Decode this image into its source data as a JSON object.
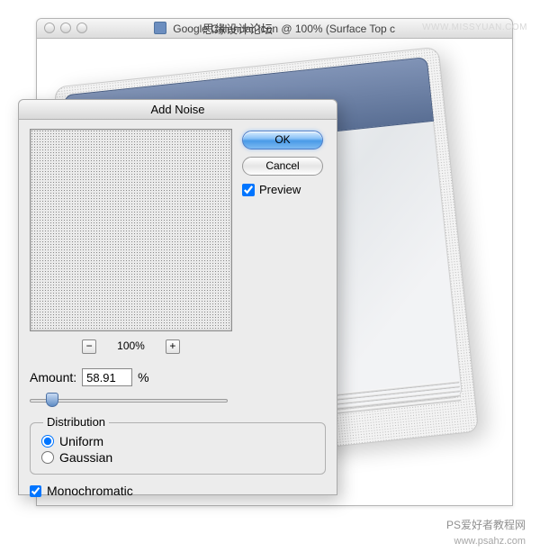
{
  "doc_window": {
    "title": "Google Calendar Icon @ 100% (Surface Top c"
  },
  "dialog": {
    "title": "Add Noise",
    "buttons": {
      "ok": "OK",
      "cancel": "Cancel"
    },
    "preview_label": "Preview",
    "zoom": {
      "out": "−",
      "in": "+",
      "value": "100%"
    },
    "amount": {
      "label": "Amount:",
      "value": "58.91",
      "unit": "%"
    },
    "distribution": {
      "legend": "Distribution",
      "uniform": "Uniform",
      "gaussian": "Gaussian",
      "selected": "uniform"
    },
    "monochromatic": "Monochromatic"
  },
  "watermarks": {
    "top_right": "WWW.MISSYUAN.COM",
    "center_overlay": "思缘设计论坛",
    "bottom_label": "PS爱好者教程网",
    "bottom_url": "www.psahz.com"
  }
}
